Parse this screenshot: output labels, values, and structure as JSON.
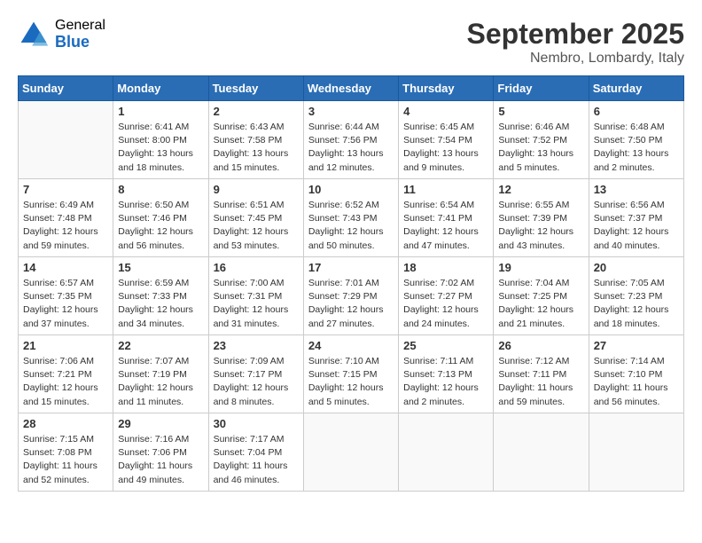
{
  "header": {
    "logo_general": "General",
    "logo_blue": "Blue",
    "month": "September 2025",
    "location": "Nembro, Lombardy, Italy"
  },
  "weekdays": [
    "Sunday",
    "Monday",
    "Tuesday",
    "Wednesday",
    "Thursday",
    "Friday",
    "Saturday"
  ],
  "weeks": [
    [
      {
        "day": "",
        "info": ""
      },
      {
        "day": "1",
        "info": "Sunrise: 6:41 AM\nSunset: 8:00 PM\nDaylight: 13 hours\nand 18 minutes."
      },
      {
        "day": "2",
        "info": "Sunrise: 6:43 AM\nSunset: 7:58 PM\nDaylight: 13 hours\nand 15 minutes."
      },
      {
        "day": "3",
        "info": "Sunrise: 6:44 AM\nSunset: 7:56 PM\nDaylight: 13 hours\nand 12 minutes."
      },
      {
        "day": "4",
        "info": "Sunrise: 6:45 AM\nSunset: 7:54 PM\nDaylight: 13 hours\nand 9 minutes."
      },
      {
        "day": "5",
        "info": "Sunrise: 6:46 AM\nSunset: 7:52 PM\nDaylight: 13 hours\nand 5 minutes."
      },
      {
        "day": "6",
        "info": "Sunrise: 6:48 AM\nSunset: 7:50 PM\nDaylight: 13 hours\nand 2 minutes."
      }
    ],
    [
      {
        "day": "7",
        "info": "Sunrise: 6:49 AM\nSunset: 7:48 PM\nDaylight: 12 hours\nand 59 minutes."
      },
      {
        "day": "8",
        "info": "Sunrise: 6:50 AM\nSunset: 7:46 PM\nDaylight: 12 hours\nand 56 minutes."
      },
      {
        "day": "9",
        "info": "Sunrise: 6:51 AM\nSunset: 7:45 PM\nDaylight: 12 hours\nand 53 minutes."
      },
      {
        "day": "10",
        "info": "Sunrise: 6:52 AM\nSunset: 7:43 PM\nDaylight: 12 hours\nand 50 minutes."
      },
      {
        "day": "11",
        "info": "Sunrise: 6:54 AM\nSunset: 7:41 PM\nDaylight: 12 hours\nand 47 minutes."
      },
      {
        "day": "12",
        "info": "Sunrise: 6:55 AM\nSunset: 7:39 PM\nDaylight: 12 hours\nand 43 minutes."
      },
      {
        "day": "13",
        "info": "Sunrise: 6:56 AM\nSunset: 7:37 PM\nDaylight: 12 hours\nand 40 minutes."
      }
    ],
    [
      {
        "day": "14",
        "info": "Sunrise: 6:57 AM\nSunset: 7:35 PM\nDaylight: 12 hours\nand 37 minutes."
      },
      {
        "day": "15",
        "info": "Sunrise: 6:59 AM\nSunset: 7:33 PM\nDaylight: 12 hours\nand 34 minutes."
      },
      {
        "day": "16",
        "info": "Sunrise: 7:00 AM\nSunset: 7:31 PM\nDaylight: 12 hours\nand 31 minutes."
      },
      {
        "day": "17",
        "info": "Sunrise: 7:01 AM\nSunset: 7:29 PM\nDaylight: 12 hours\nand 27 minutes."
      },
      {
        "day": "18",
        "info": "Sunrise: 7:02 AM\nSunset: 7:27 PM\nDaylight: 12 hours\nand 24 minutes."
      },
      {
        "day": "19",
        "info": "Sunrise: 7:04 AM\nSunset: 7:25 PM\nDaylight: 12 hours\nand 21 minutes."
      },
      {
        "day": "20",
        "info": "Sunrise: 7:05 AM\nSunset: 7:23 PM\nDaylight: 12 hours\nand 18 minutes."
      }
    ],
    [
      {
        "day": "21",
        "info": "Sunrise: 7:06 AM\nSunset: 7:21 PM\nDaylight: 12 hours\nand 15 minutes."
      },
      {
        "day": "22",
        "info": "Sunrise: 7:07 AM\nSunset: 7:19 PM\nDaylight: 12 hours\nand 11 minutes."
      },
      {
        "day": "23",
        "info": "Sunrise: 7:09 AM\nSunset: 7:17 PM\nDaylight: 12 hours\nand 8 minutes."
      },
      {
        "day": "24",
        "info": "Sunrise: 7:10 AM\nSunset: 7:15 PM\nDaylight: 12 hours\nand 5 minutes."
      },
      {
        "day": "25",
        "info": "Sunrise: 7:11 AM\nSunset: 7:13 PM\nDaylight: 12 hours\nand 2 minutes."
      },
      {
        "day": "26",
        "info": "Sunrise: 7:12 AM\nSunset: 7:11 PM\nDaylight: 11 hours\nand 59 minutes."
      },
      {
        "day": "27",
        "info": "Sunrise: 7:14 AM\nSunset: 7:10 PM\nDaylight: 11 hours\nand 56 minutes."
      }
    ],
    [
      {
        "day": "28",
        "info": "Sunrise: 7:15 AM\nSunset: 7:08 PM\nDaylight: 11 hours\nand 52 minutes."
      },
      {
        "day": "29",
        "info": "Sunrise: 7:16 AM\nSunset: 7:06 PM\nDaylight: 11 hours\nand 49 minutes."
      },
      {
        "day": "30",
        "info": "Sunrise: 7:17 AM\nSunset: 7:04 PM\nDaylight: 11 hours\nand 46 minutes."
      },
      {
        "day": "",
        "info": ""
      },
      {
        "day": "",
        "info": ""
      },
      {
        "day": "",
        "info": ""
      },
      {
        "day": "",
        "info": ""
      }
    ]
  ]
}
